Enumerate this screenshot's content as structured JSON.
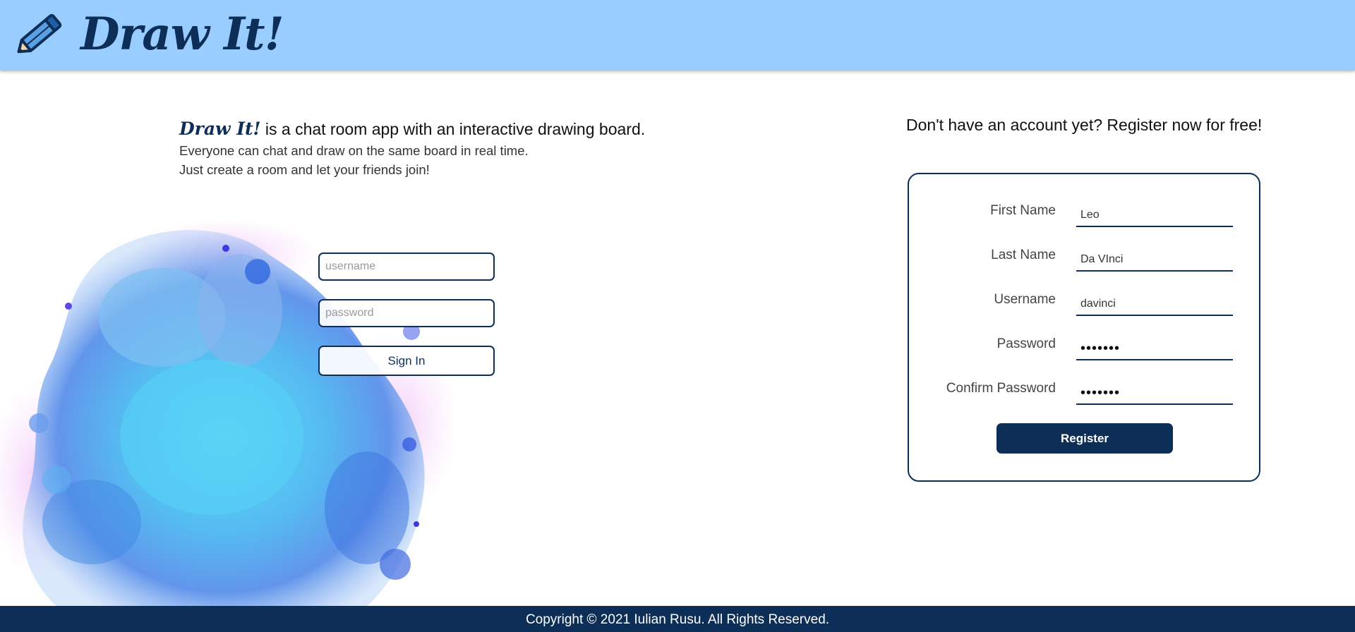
{
  "header": {
    "logo_text": "Draw It!",
    "logo_icon": "pencil-icon"
  },
  "intro": {
    "brand": "Draw It!",
    "tagline": " is a chat room app with an interactive drawing board.",
    "line2": "Everyone can chat and draw on the same board in real time.",
    "line3": "Just create a room and let your friends join!"
  },
  "signin": {
    "username_placeholder": "username",
    "password_placeholder": "password",
    "button_label": "Sign In"
  },
  "register": {
    "title": "Don't have an account yet? Register now for free!",
    "fields": [
      {
        "label": "First Name",
        "value": "Leo"
      },
      {
        "label": "Last Name",
        "value": "Da VInci"
      },
      {
        "label": "Username",
        "value": "davinci"
      },
      {
        "label": "Password",
        "value": "•••••••"
      },
      {
        "label": "Confirm Password",
        "value": "•••••••"
      }
    ],
    "button_label": "Register"
  },
  "footer": {
    "copyright": "Copyright © 2021 Iulian Rusu. All Rights Reserved."
  },
  "colors": {
    "header_bg": "#99ccff",
    "brand_navy": "#0d2f57",
    "footer_bg": "#0d2f57"
  }
}
